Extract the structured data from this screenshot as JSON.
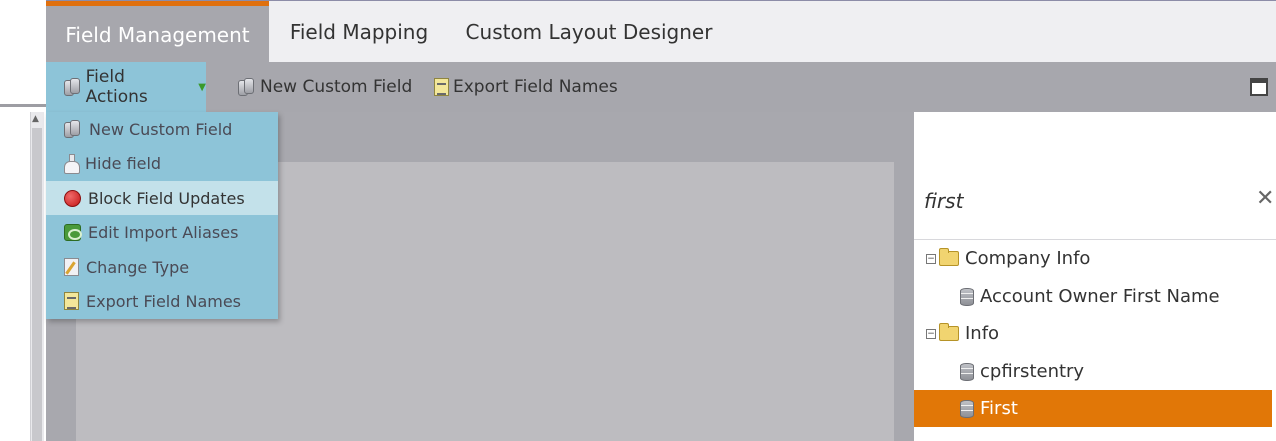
{
  "tabs": [
    {
      "label": "Field Management",
      "active": true
    },
    {
      "label": "Field Mapping",
      "active": false
    },
    {
      "label": "Custom Layout Designer",
      "active": false
    }
  ],
  "toolbar": {
    "field_actions_label": "Field Actions",
    "new_custom_field_label": "New Custom Field",
    "export_field_names_label": "Export Field Names"
  },
  "dropdown": {
    "items": [
      {
        "label": "New Custom Field",
        "icon": "db-stack-icon"
      },
      {
        "label": "Hide field",
        "icon": "flask-icon"
      },
      {
        "label": "Block Field Updates",
        "icon": "block-icon",
        "highlighted": true
      },
      {
        "label": "Edit Import Aliases",
        "icon": "alias-icon"
      },
      {
        "label": "Change Type",
        "icon": "change-type-icon"
      },
      {
        "label": "Export Field Names",
        "icon": "list-icon"
      }
    ]
  },
  "search": {
    "value": "first"
  },
  "tree": {
    "groups": [
      {
        "label": "Company Info",
        "icon": "folder-icon",
        "items": [
          {
            "label": "Account Owner First Name",
            "icon": "database-icon"
          }
        ]
      },
      {
        "label": "Info",
        "icon": "folder-icon",
        "items": [
          {
            "label": "cpfirstentry",
            "icon": "database-icon"
          },
          {
            "label": "First",
            "icon": "database-icon",
            "selected": true
          }
        ]
      }
    ]
  },
  "colors": {
    "accent": "#e17707",
    "menu": "#8dc4d8",
    "menu_highlight": "#c3e1ea",
    "toolbar": "#a7a7ad"
  }
}
